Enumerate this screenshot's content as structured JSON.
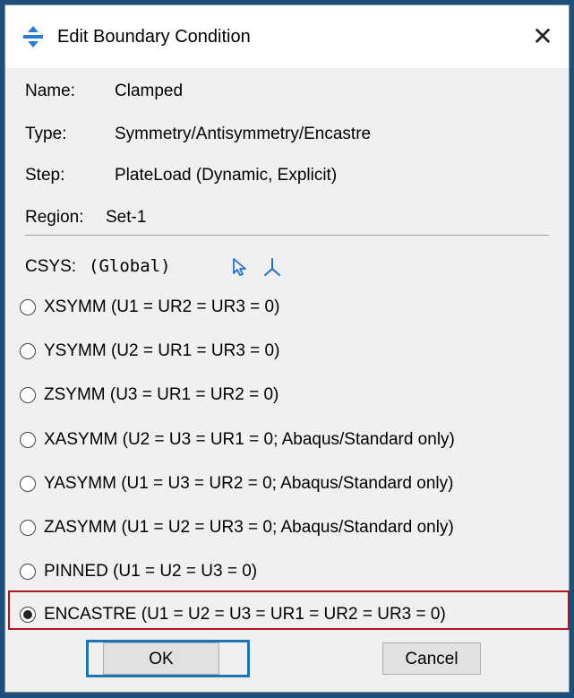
{
  "window": {
    "title": "Edit Boundary Condition",
    "close_glyph": "✕"
  },
  "fields": [
    {
      "label": "Name:",
      "value": "Clamped"
    },
    {
      "label": "Type:",
      "value": "Symmetry/Antisymmetry/Encastre"
    },
    {
      "label": "Step:",
      "value": "PlateLoad (Dynamic, Explicit)"
    },
    {
      "label": "Region:",
      "value": "Set-1"
    }
  ],
  "csys": {
    "label": "CSYS:",
    "value": "(Global)",
    "select_icon": "arrow-cursor-icon",
    "create_icon": "coordinate-axes-icon"
  },
  "options": [
    {
      "label": "XSYMM (U1 = UR2 = UR3 = 0)",
      "selected": false
    },
    {
      "label": "YSYMM (U2 = UR1 = UR3 = 0)",
      "selected": false
    },
    {
      "label": "ZSYMM (U3 = UR1 = UR2 = 0)",
      "selected": false
    },
    {
      "label": "XASYMM (U2 = U3 = UR1 = 0; Abaqus/Standard only)",
      "selected": false
    },
    {
      "label": "YASYMM (U1 = U3 = UR2 = 0; Abaqus/Standard only)",
      "selected": false
    },
    {
      "label": "ZASYMM (U1 = U2 = UR3 = 0; Abaqus/Standard only)",
      "selected": false
    },
    {
      "label": "PINNED (U1 = U2 = U3 = 0)",
      "selected": false
    },
    {
      "label": "ENCASTRE (U1 = U2 = U3 = UR1 = UR2 = UR3 = 0)",
      "selected": true
    }
  ],
  "buttons": {
    "ok": "OK",
    "cancel": "Cancel"
  },
  "colors": {
    "highlight_border": "#b0161b",
    "focus_outline": "#1f74b8",
    "icon_blue": "#1e73d6"
  }
}
